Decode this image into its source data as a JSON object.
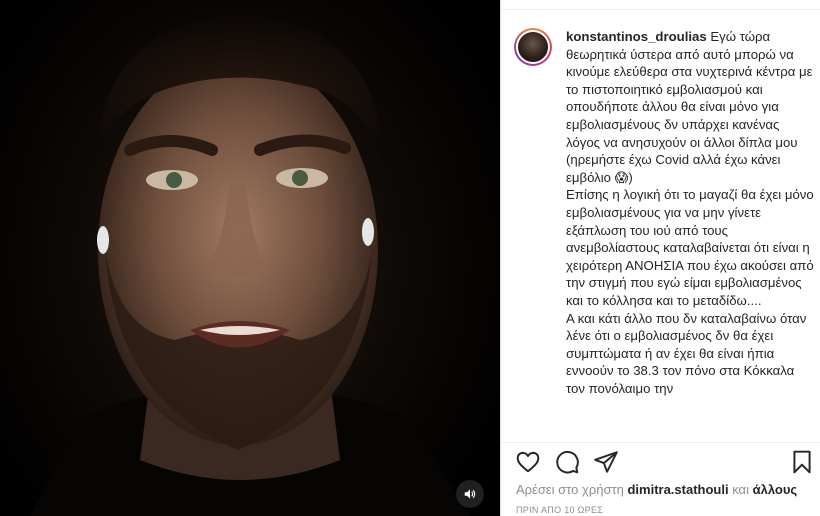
{
  "post": {
    "username": "konstantinos_droulias",
    "caption": " Εγώ τώρα θεωρητικά ύστερα από αυτό μπορώ να κινούμε ελεύθερα στα νυχτερινά κέντρα με το πιστοποιητικό εμβολιασμού και οπουδήποτε άλλου θα είναι μόνο για εμβολιασμένους δν υπάρχει κανένας λόγος να ανησυχούν οι άλλοι δίπλα μου (ηρεμήστε έχω Covid αλλά έχω κάνει εμβόλιο 😱)\nΕπίσης η λογική ότι το μαγαζί θα έχει μόνο εμβολιασμένους για να μην γίνετε εξάπλωση του ιού από τους ανεμβολίαστους καταλαβαίνεται ότι είναι η χειρότερη ΑΝΟΗΣΙΑ που έχω ακούσει από την στιγμή που εγώ είμαι εμβολιασμένος και το κόλλησα και το μεταδίδω....\nΑ και κάτι άλλο που δν καταλαβαίνω όταν λένε ότι ο εμβολιασμένος δν θα έχει συμπτώματα ή αν έχει θα είναι ήπια εννοούν το 38.3 τον πόνο στα Κόκκαλα τον πονόλαιμο την",
    "likes_prefix": "Αρέσει στο χρήστη",
    "liked_by": "dimitra.stathouli",
    "likes_joiner": "και",
    "likes_others": "άλλους",
    "timestamp": "ΠΡΙΝ ΑΠΟ 10 ΩΡΕΣ"
  },
  "icons": {
    "like": "heart-icon",
    "comment": "comment-icon",
    "share": "paper-plane-icon",
    "save": "bookmark-icon",
    "mute": "speaker-icon"
  },
  "colors": {
    "text": "#262626",
    "secondary": "#8e8e8e",
    "border": "#dbdbdb"
  }
}
